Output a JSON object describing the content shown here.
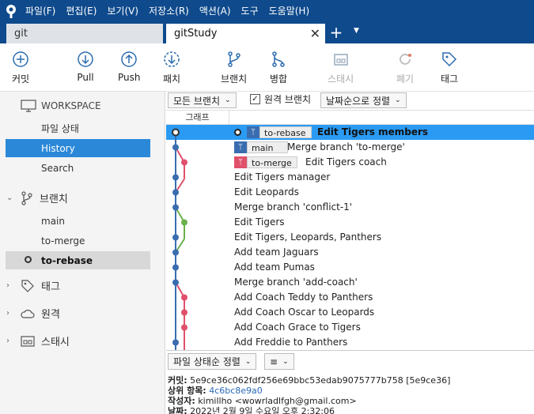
{
  "menu": [
    "파일(F)",
    "편집(E)",
    "보기(V)",
    "저장소(R)",
    "액션(A)",
    "도구",
    "도움말(H)"
  ],
  "tabs": {
    "inactive": "git",
    "active": "gitStudy"
  },
  "toolbar": {
    "commit": "커밋",
    "pull": "Pull",
    "push": "Push",
    "fetch": "패치",
    "branch": "브랜치",
    "merge": "병합",
    "stash": "스태시",
    "discard": "폐기",
    "tag": "태그"
  },
  "sidebar": {
    "workspace": "WORKSPACE",
    "file_status": "파일 상태",
    "history": "History",
    "search": "Search",
    "branches": "브랜치",
    "branch_items": [
      "main",
      "to-merge",
      "to-rebase"
    ],
    "tags": "태그",
    "remotes": "원격",
    "stashes": "스태시"
  },
  "filters": {
    "all_branches": "모든 브랜치",
    "remote_branches": "원격 브랜치",
    "sort": "날짜순으로 정렬"
  },
  "columns": {
    "graph": "그래프"
  },
  "commits": [
    {
      "msg": "Edit Tigers members",
      "badge": "to-rebase"
    },
    {
      "msg": "Merge branch 'to-merge'",
      "badge": "main"
    },
    {
      "msg": "Edit Tigers coach",
      "badge": "to-merge"
    },
    {
      "msg": "Edit Tigers manager"
    },
    {
      "msg": "Edit Leopards"
    },
    {
      "msg": "Merge branch 'conflict-1'"
    },
    {
      "msg": "Edit Tigers"
    },
    {
      "msg": "Edit Tigers, Leopards, Panthers"
    },
    {
      "msg": "Add team Jaguars"
    },
    {
      "msg": "Add team Pumas"
    },
    {
      "msg": "Merge branch 'add-coach'"
    },
    {
      "msg": "Add Coach Teddy to Panthers"
    },
    {
      "msg": "Add Coach Oscar to Leopards"
    },
    {
      "msg": "Add Coach Grace to Tigers"
    },
    {
      "msg": "Add Freddie to Panthers"
    }
  ],
  "bottom": {
    "file_sort": "파일 상태순 정렬",
    "view_icon": "≡"
  },
  "details": {
    "commit_label": "커밋:",
    "commit_value": "5e9ce36c062fdf256e69bbc53edab9075777b758 [5e9ce36]",
    "parent_label": "상위 항목:",
    "parent_value": "4c6bc8e9a0",
    "author_label": "작성자:",
    "author_value": "kimillho <wowrladlfgh@gmail.com>",
    "date_label": "날짜:",
    "date_value": "2022년 2월 9일 수요일 오후 2:32:06"
  },
  "colors": {
    "titlebar": "#0f4a8c",
    "selected": "#2b9af3",
    "branch_blue": "#3a6db0",
    "branch_pink": "#e0506a",
    "branch_green": "#6ab04c"
  }
}
